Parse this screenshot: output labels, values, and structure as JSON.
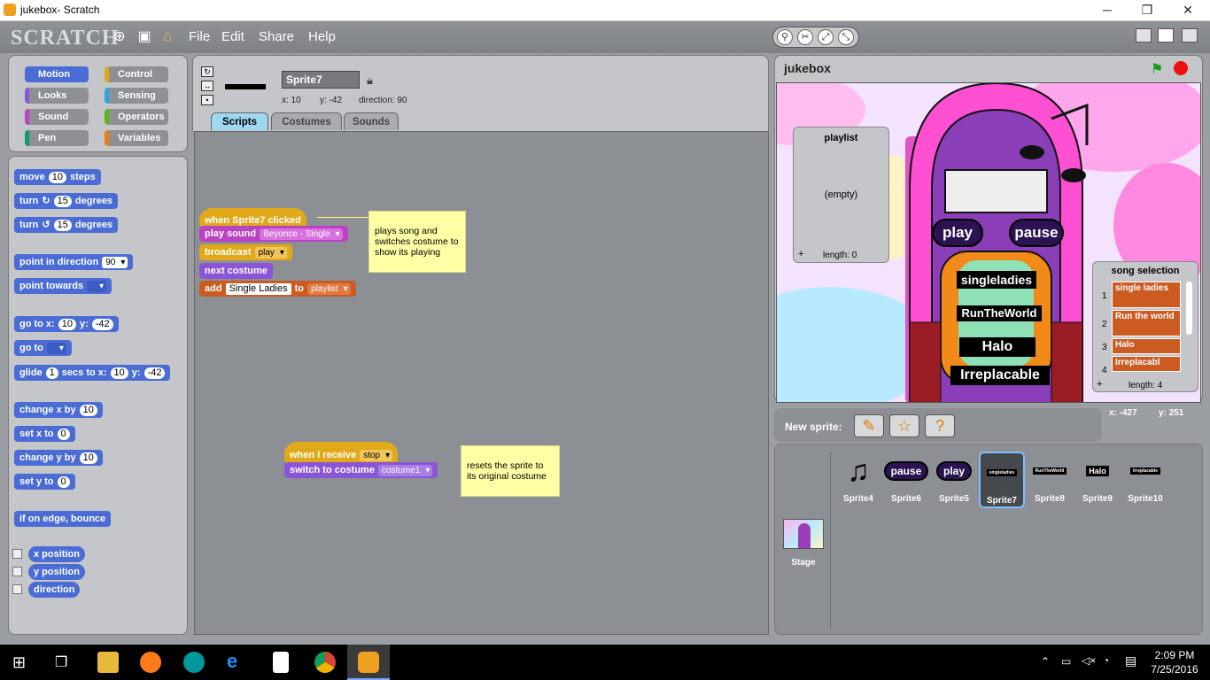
{
  "window": {
    "title": "jukebox- Scratch",
    "minimize": "─",
    "maximize": "❐",
    "close": "✕"
  },
  "menubar": {
    "logo": "SCRATCH",
    "file": "File",
    "edit": "Edit",
    "share": "Share",
    "help": "Help"
  },
  "categories": [
    {
      "label": "Motion",
      "color": "#4a6cd4"
    },
    {
      "label": "Control",
      "color": "#e1a91a"
    },
    {
      "label": "Looks",
      "color": "#8a55d7"
    },
    {
      "label": "Sensing",
      "color": "#2ca5e2"
    },
    {
      "label": "Sound",
      "color": "#bb42c3"
    },
    {
      "label": "Operators",
      "color": "#5cb712"
    },
    {
      "label": "Pen",
      "color": "#0e9a6c"
    },
    {
      "label": "Variables",
      "color": "#ee7d16"
    }
  ],
  "palette": {
    "move": {
      "a": "move",
      "v": "10",
      "b": "steps"
    },
    "turn_cw": {
      "a": "turn",
      "v": "15",
      "b": "degrees"
    },
    "turn_ccw": {
      "a": "turn",
      "v": "15",
      "b": "degrees"
    },
    "point_dir": {
      "a": "point in direction",
      "v": "90"
    },
    "point_towards": {
      "a": "point towards"
    },
    "goto_xy": {
      "a": "go to x:",
      "x": "10",
      "b": "y:",
      "y": "-42"
    },
    "goto": {
      "a": "go to"
    },
    "glide": {
      "a": "glide",
      "s": "1",
      "b": "secs to x:",
      "x": "10",
      "c": "y:",
      "y": "-42"
    },
    "change_x": {
      "a": "change x by",
      "v": "10"
    },
    "set_x": {
      "a": "set x to",
      "v": "0"
    },
    "change_y": {
      "a": "change y by",
      "v": "10"
    },
    "set_y": {
      "a": "set y to",
      "v": "0"
    },
    "bounce": "if on edge, bounce",
    "xpos": "x position",
    "ypos": "y position",
    "direction": "direction"
  },
  "sprite": {
    "name": "Sprite7",
    "x": "x: 10",
    "y": "y: -42",
    "dir": "direction: 90"
  },
  "tabs": {
    "scripts": "Scripts",
    "costumes": "Costumes",
    "sounds": "Sounds"
  },
  "script1": {
    "hat": "when Sprite7 clicked",
    "play": "play sound",
    "play_dd": "Beyonce - Single",
    "broadcast": "broadcast",
    "broadcast_dd": "play",
    "next": "next costume",
    "add": "add",
    "add_val": "Single Ladies",
    "to": "to",
    "list_dd": "playlist",
    "note": "plays song and switches costume to show its playing"
  },
  "script2": {
    "hat": "when I receive",
    "hat_dd": "stop",
    "switch": "switch to costume",
    "switch_dd": "costume1",
    "note": "resets the sprite to its original costume"
  },
  "stage": {
    "title": "jukebox",
    "playlist": {
      "title": "playlist",
      "empty": "(empty)",
      "plus": "+",
      "length": "length: 0"
    },
    "songsel": {
      "title": "song selection",
      "items": [
        "single ladies",
        "Run the world",
        "Halo",
        "Irreplacabl"
      ],
      "idx": [
        "1",
        "2",
        "3",
        "4"
      ],
      "plus": "+",
      "length": "length: 4"
    },
    "play": "play",
    "pause": "pause",
    "songs": [
      "singleladies",
      "RunTheWorld",
      "Halo",
      "Irreplacable"
    ]
  },
  "coords": {
    "x": "x: -427",
    "y": "y: 251"
  },
  "newsprite": "New sprite:",
  "sprites": [
    {
      "name": "Sprite4",
      "thumb": "♫"
    },
    {
      "name": "Sprite6",
      "thumb": "pause"
    },
    {
      "name": "Sprite5",
      "thumb": "play"
    },
    {
      "name": "Sprite7",
      "thumb": "singleladies"
    },
    {
      "name": "Sprite8",
      "thumb": "RunTheWorld"
    },
    {
      "name": "Sprite9",
      "thumb": "Halo"
    },
    {
      "name": "Sprite10",
      "thumb": "Irreplacable"
    }
  ],
  "stage_label": "Stage",
  "taskbar": {
    "time": "2:09 PM",
    "date": "7/25/2016"
  }
}
